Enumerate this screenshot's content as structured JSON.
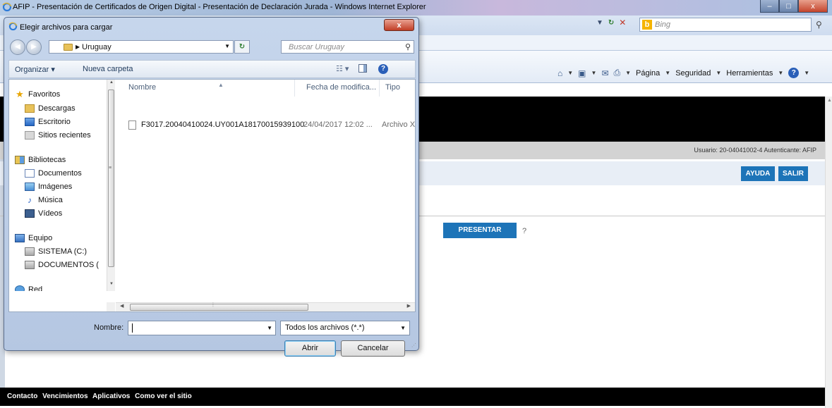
{
  "ie": {
    "title": "AFIP - Presentación de Certificados de Origen Digital - Presentación de Declaración Jurada - Windows Internet Explorer",
    "search_placeholder": "Bing",
    "window_buttons": {
      "minimize": "–",
      "maximize": "□",
      "close": "x"
    },
    "command_bar": {
      "page": "Página",
      "security": "Seguridad",
      "tools": "Herramientas"
    }
  },
  "page": {
    "user_text": "Usuario: 20-04041002-4 Autenticante: AFIP",
    "buttons": {
      "help": "AYUDA",
      "exit": "SALIR",
      "present": "PRESENTAR"
    },
    "question": "?",
    "footer_links": [
      "Contacto",
      "Vencimientos",
      "Aplicativos",
      "Como ver el sitio"
    ]
  },
  "dialog": {
    "title": "Elegir archivos para cargar",
    "close_label": "x",
    "path": "Uruguay",
    "search_placeholder": "Buscar Uruguay",
    "toolbar": {
      "organize": "Organizar ▾",
      "new_folder": "Nueva carpeta"
    },
    "nav_items": [
      {
        "label": "Favoritos",
        "icon": "star-icon"
      },
      {
        "label": "Descargas",
        "icon": "downloads-folder-icon"
      },
      {
        "label": "Escritorio",
        "icon": "desktop-icon"
      },
      {
        "label": "Sitios recientes",
        "icon": "recent-places-icon"
      },
      {
        "label": "Bibliotecas",
        "icon": "libraries-icon"
      },
      {
        "label": "Documentos",
        "icon": "documents-icon"
      },
      {
        "label": "Imágenes",
        "icon": "pictures-icon"
      },
      {
        "label": "Música",
        "icon": "music-icon"
      },
      {
        "label": "Vídeos",
        "icon": "videos-icon"
      },
      {
        "label": "Equipo",
        "icon": "computer-icon"
      },
      {
        "label": "SISTEMA (C:)",
        "icon": "drive-icon"
      },
      {
        "label": "DOCUMENTOS (",
        "icon": "drive-icon"
      },
      {
        "label": "Red",
        "icon": "network-icon"
      }
    ],
    "columns": {
      "name": "Nombre",
      "date": "Fecha de modifica...",
      "type": "Tipo"
    },
    "files": [
      {
        "name": "F3017.20040410024.UY001A18170015939100",
        "date": "24/04/2017 12:02 ...",
        "type": "Archivo X"
      }
    ],
    "filename_label": "Nombre:",
    "filename_value": "",
    "file_type": "Todos los archivos (*.*)",
    "open_button": "Abrir",
    "cancel_button": "Cancelar"
  }
}
